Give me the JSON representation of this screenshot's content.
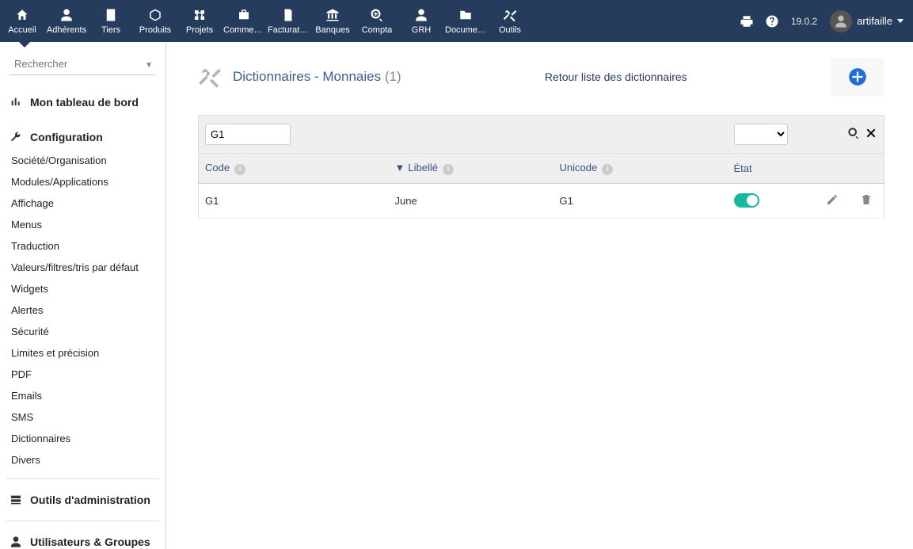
{
  "topnav": {
    "items": [
      {
        "label": "Accueil",
        "icon": "home"
      },
      {
        "label": "Adhérents",
        "icon": "user"
      },
      {
        "label": "Tiers",
        "icon": "building"
      },
      {
        "label": "Produits",
        "icon": "cube"
      },
      {
        "label": "Projets",
        "icon": "project"
      },
      {
        "label": "Commerce",
        "icon": "briefcase"
      },
      {
        "label": "Facturation",
        "icon": "invoice"
      },
      {
        "label": "Banques",
        "icon": "bank"
      },
      {
        "label": "Compta",
        "icon": "search-plus"
      },
      {
        "label": "GRH",
        "icon": "user"
      },
      {
        "label": "Documents",
        "icon": "folder"
      },
      {
        "label": "Outils",
        "icon": "tools"
      }
    ],
    "version": "19.0.2",
    "username": "artifaille"
  },
  "sidebar": {
    "search_placeholder": "Rechercher",
    "dashboard_label": "Mon tableau de bord",
    "config_label": "Configuration",
    "config_items": [
      "Société/Organisation",
      "Modules/Applications",
      "Affichage",
      "Menus",
      "Traduction",
      "Valeurs/filtres/tris par défaut",
      "Widgets",
      "Alertes",
      "Sécurité",
      "Limites et précision",
      "PDF",
      "Emails",
      "SMS",
      "Dictionnaires",
      "Divers"
    ],
    "admin_tools_label": "Outils d'administration",
    "users_groups_label": "Utilisateurs & Groupes"
  },
  "page": {
    "title": "Dictionnaires - Monnaies",
    "count": "(1)",
    "back_link": "Retour liste des dictionnaires"
  },
  "table": {
    "filter_code_value": "G1",
    "columns": {
      "code": "Code",
      "label": "Libellé",
      "unicode": "Unicode",
      "state": "État"
    },
    "rows": [
      {
        "code": "G1",
        "label": "June",
        "unicode": "G1",
        "state": true
      }
    ]
  }
}
